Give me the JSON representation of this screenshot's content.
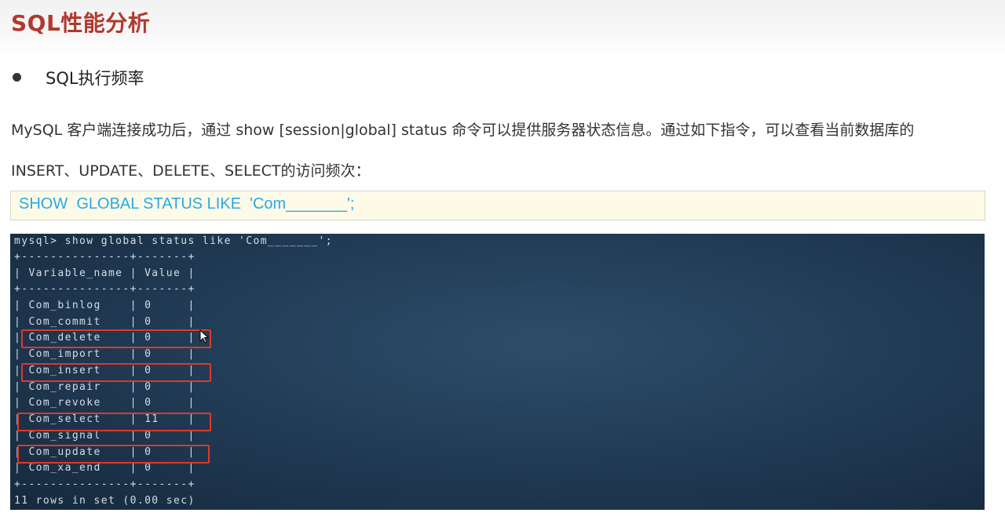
{
  "page_title": "SQL性能分析",
  "section": {
    "heading": "SQL执行频率"
  },
  "paragraph": {
    "line1": "MySQL 客户端连接成功后，通过 show [session|global] status 命令可以提供服务器状态信息。通过如下指令，可以查看当前数据库的",
    "line2": "INSERT、UPDATE、DELETE、SELECT的访问频次："
  },
  "code": "SHOW  GLOBAL STATUS LIKE  'Com_______';",
  "terminal": {
    "prompt_line": "mysql> show global status like 'Com_______';",
    "border_line": "+---------------+-------+",
    "header_line": "| Variable_name | Value |",
    "rows": [
      "| Com_binlog    | 0     |",
      "| Com_commit    | 0     |",
      "| Com_delete    | 0     |",
      "| Com_import    | 0     |",
      "| Com_insert    | 0     |",
      "| Com_repair    | 0     |",
      "| Com_revoke    | 0     |",
      "| Com_select    | 11    |",
      "| Com_signal    | 0     |",
      "| Com_update    | 0     |",
      "| Com_xa_end    | 0     |"
    ],
    "footer": "11 rows in set (0.00 sec)"
  },
  "highlighted_rows": [
    "Com_delete",
    "Com_insert",
    "Com_select",
    "Com_update"
  ],
  "colors": {
    "title": "#b03a2e",
    "code_text": "#29a9e0",
    "code_bg": "#fdfbe8",
    "highlight": "#e0382b",
    "terminal_bg": "#213b55"
  }
}
